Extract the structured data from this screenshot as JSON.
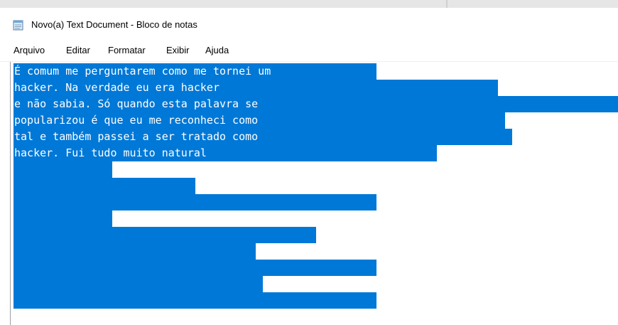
{
  "window": {
    "title": "Novo(a) Text Document - Bloco de notas",
    "icon": "notepad-icon"
  },
  "menu": {
    "items": [
      "Arquivo",
      "Editar",
      "Formatar",
      "Exibir",
      "Ajuda"
    ]
  },
  "editor": {
    "selection_color": "#0078d7",
    "lines": [
      "É comum me perguntarem como me tornei um",
      "hacker. Na verdade eu era hacker",
      "e não sabia. Só quando esta palavra se",
      "popularizou é que eu me reconheci como",
      "tal e também passei a ser tratado como",
      "hacker. Fui tudo muito natural",
      "",
      "",
      "",
      "",
      "",
      "",
      "",
      "",
      "",
      ""
    ]
  }
}
